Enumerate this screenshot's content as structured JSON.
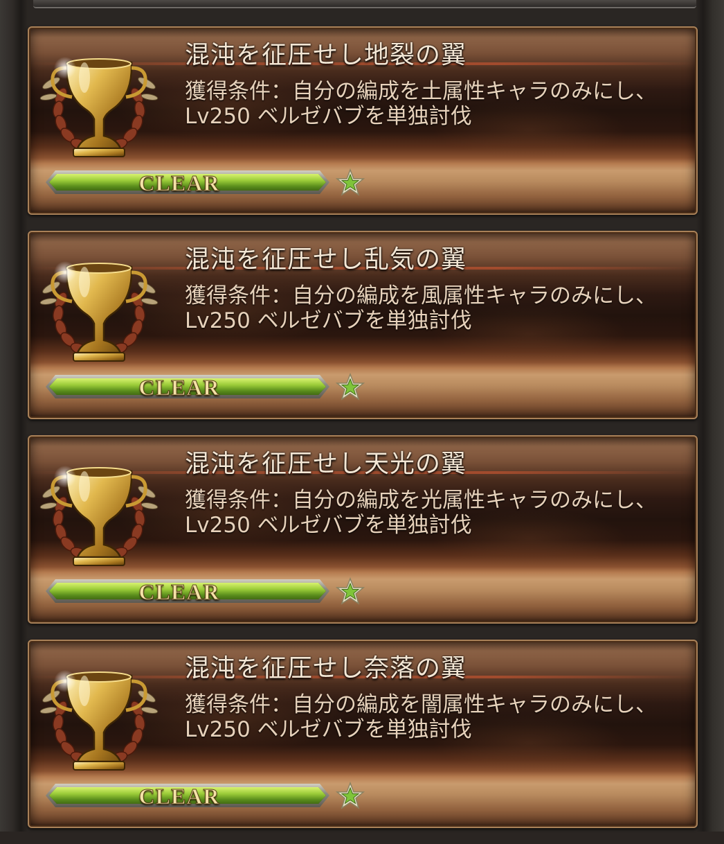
{
  "achievements": [
    {
      "title": "混沌を征圧せし地裂の翼",
      "condition_line1": "獲得条件：自分の編成を土属性キャラのみにし、",
      "condition_line2": "Lv250 ベルゼバブを単独討伐",
      "status": "CLEAR",
      "progress": 1.0,
      "trophy_icon": "gold-trophy-laurel-icon",
      "star_icon": "green-star-icon"
    },
    {
      "title": "混沌を征圧せし乱気の翼",
      "condition_line1": "獲得条件：自分の編成を風属性キャラのみにし、",
      "condition_line2": "Lv250 ベルゼバブを単独討伐",
      "status": "CLEAR",
      "progress": 1.0,
      "trophy_icon": "gold-trophy-laurel-icon",
      "star_icon": "green-star-icon"
    },
    {
      "title": "混沌を征圧せし天光の翼",
      "condition_line1": "獲得条件：自分の編成を光属性キャラのみにし、",
      "condition_line2": "Lv250 ベルゼバブを単独討伐",
      "status": "CLEAR",
      "progress": 1.0,
      "trophy_icon": "gold-trophy-laurel-icon",
      "star_icon": "green-star-icon"
    },
    {
      "title": "混沌を征圧せし奈落の翼",
      "condition_line1": "獲得条件：自分の編成を闇属性キャラのみにし、",
      "condition_line2": "Lv250 ベルゼバブを単独討伐",
      "status": "CLEAR",
      "progress": 1.0,
      "trophy_icon": "gold-trophy-laurel-icon",
      "star_icon": "green-star-icon"
    }
  ],
  "colors": {
    "progress_fill": "#9acb38",
    "star_fill": "#7fc43a",
    "trophy_gold": "#d9b04a",
    "laurel": "#8a3a22"
  }
}
